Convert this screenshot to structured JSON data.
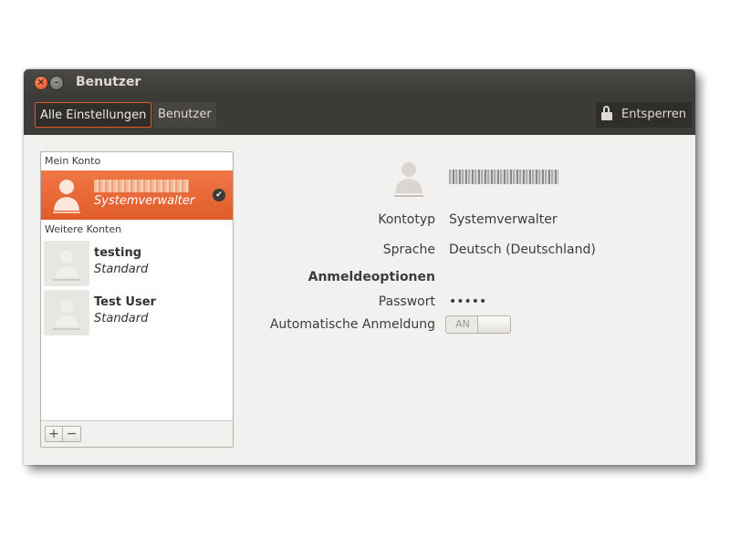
{
  "window": {
    "title": "Benutzer"
  },
  "toolbar": {
    "breadcrumb_all": "Alle Einstellungen",
    "breadcrumb_current": "Benutzer",
    "unlock_label": "Entsperren"
  },
  "user_list": {
    "my_account_header": "Mein Konto",
    "other_accounts_header": "Weitere Konten",
    "current_user": {
      "role": "Systemverwalter"
    },
    "others": [
      {
        "name": "testing",
        "role": "Standard"
      },
      {
        "name": "Test User",
        "role": "Standard"
      }
    ],
    "add_symbol": "+",
    "remove_symbol": "−"
  },
  "details": {
    "account_type_label": "Kontotyp",
    "account_type_value": "Systemverwalter",
    "language_label": "Sprache",
    "language_value": "Deutsch (Deutschland)",
    "login_options_header": "Anmeldeoptionen",
    "password_label": "Passwort",
    "password_value": "•••••",
    "autologin_label": "Automatische Anmeldung",
    "autologin_state": "AN"
  }
}
